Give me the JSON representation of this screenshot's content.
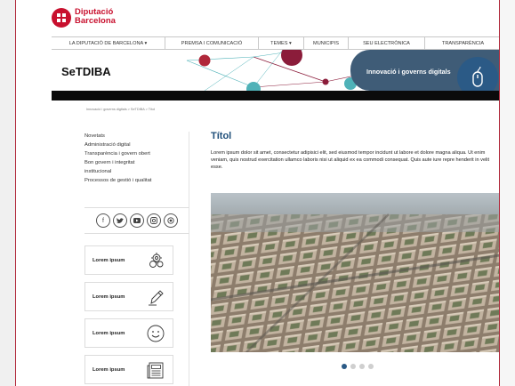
{
  "brand": {
    "name_line1": "Diputació",
    "name_line2": "Barcelona",
    "color": "#c8102e"
  },
  "topnav": {
    "items": [
      {
        "label": "LA DIPUTACIÓ DE BARCELONA ▾"
      },
      {
        "label": "PREMSA I COMUNICACIÓ"
      },
      {
        "label": "TEMES ▾"
      },
      {
        "label": "MUNICIPIS"
      },
      {
        "label": "SEU ELECTRÒNICA"
      },
      {
        "label": "TRANSPARÈNCIA"
      }
    ]
  },
  "hero": {
    "site_title": "SeTDIBA",
    "tagline": "Innovació i governs digitals",
    "accent": "#3f5c77"
  },
  "breadcrumb": {
    "text": "Innovació i governs digitals > SeTDIBA > Títol"
  },
  "sidebar": {
    "links": [
      {
        "label": "Novetats"
      },
      {
        "label": "Administració digital"
      },
      {
        "label": "Transparència i govern obert"
      },
      {
        "label": "Bon govern i integritat"
      },
      {
        "label": "institucional"
      },
      {
        "label": "Processos de gestió i qualitat"
      }
    ],
    "social": [
      {
        "icon": "facebook-icon",
        "glyph": "f"
      },
      {
        "icon": "twitter-icon",
        "glyph": "♈"
      },
      {
        "icon": "youtube-icon",
        "glyph": "▶"
      },
      {
        "icon": "instagram-icon",
        "glyph": "◎"
      },
      {
        "icon": "flickr-icon",
        "glyph": "●"
      }
    ],
    "cards": [
      {
        "label": "Lorem ipsum",
        "icon": "gears-icon"
      },
      {
        "label": "Lorem ipsum",
        "icon": "pen-icon"
      },
      {
        "label": "Lorem ipsum",
        "icon": "smiley-icon"
      },
      {
        "label": "Lorem ipsum",
        "icon": "newspaper-icon"
      }
    ]
  },
  "main": {
    "title": "Títol",
    "body": "Lorem ipsum dolor sit amet, consectetur adipisici elit, sed eiusmod tempor incidunt ut labore et dolore magna aliqua. Ut enim veniam, quis nostrud exercitation ullamco laboris nisi ut aliquid ex ea commodi consequat. Quis aute iure repre henderit in velit esse.",
    "carousel": {
      "slides": 4,
      "active": 1
    }
  }
}
